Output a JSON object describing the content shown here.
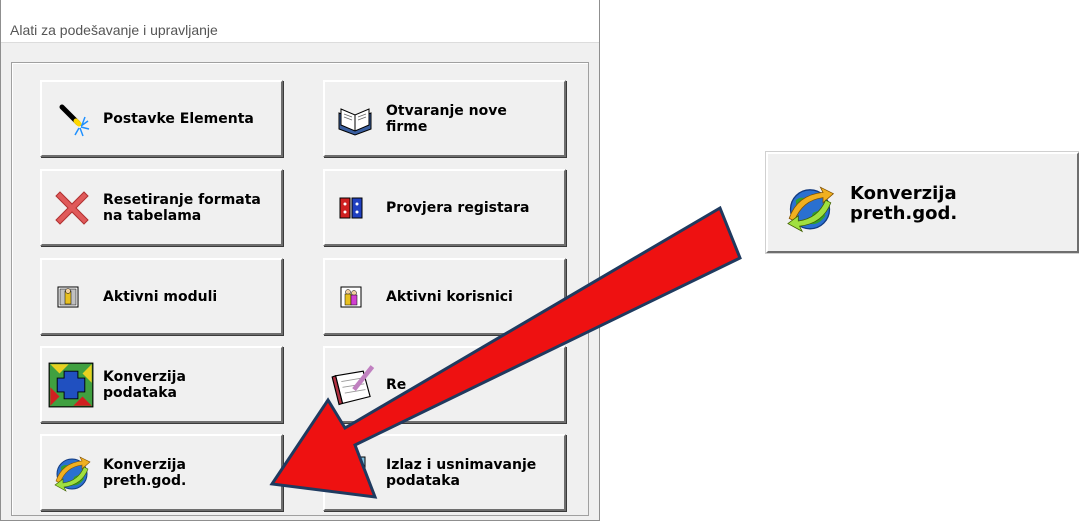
{
  "window": {
    "title": "Alati za podešavanje i upravljanje"
  },
  "buttons": [
    {
      "id": "postavke",
      "label": "Postavke Elementa",
      "icon": "magic-wand-icon"
    },
    {
      "id": "otvaranje",
      "label": "Otvaranje nove\nfirme",
      "icon": "book-icon"
    },
    {
      "id": "resetiranje",
      "label": "Resetiranje formata\nna tabelama",
      "icon": "red-x-icon"
    },
    {
      "id": "provjera",
      "label": "Provjera registara",
      "icon": "binders-icon"
    },
    {
      "id": "moduli",
      "label": "Aktivni moduli",
      "icon": "module-icon"
    },
    {
      "id": "korisnici",
      "label": "Aktivni korisnici",
      "icon": "users-icon"
    },
    {
      "id": "konverzija_podataka",
      "label": "Konverzija\npodataka",
      "icon": "convert-arrows-icon"
    },
    {
      "id": "re",
      "label": "Re",
      "icon": "notebook-pen-icon"
    },
    {
      "id": "konverzija_preth",
      "label": "Konverzija\npreth.god.",
      "icon": "globe-arrows-icon"
    },
    {
      "id": "izlaz",
      "label": "Izlaz i usnimavanje\npodataka",
      "icon": "exit-door-icon"
    }
  ],
  "zoom_callout": {
    "label": "Konverzija\npreth.god.",
    "icon": "globe-arrows-icon"
  },
  "colors": {
    "arrow_fill": "#ee1111",
    "arrow_outline": "#1f3a5f",
    "window_bg": "#f0f0f0"
  }
}
